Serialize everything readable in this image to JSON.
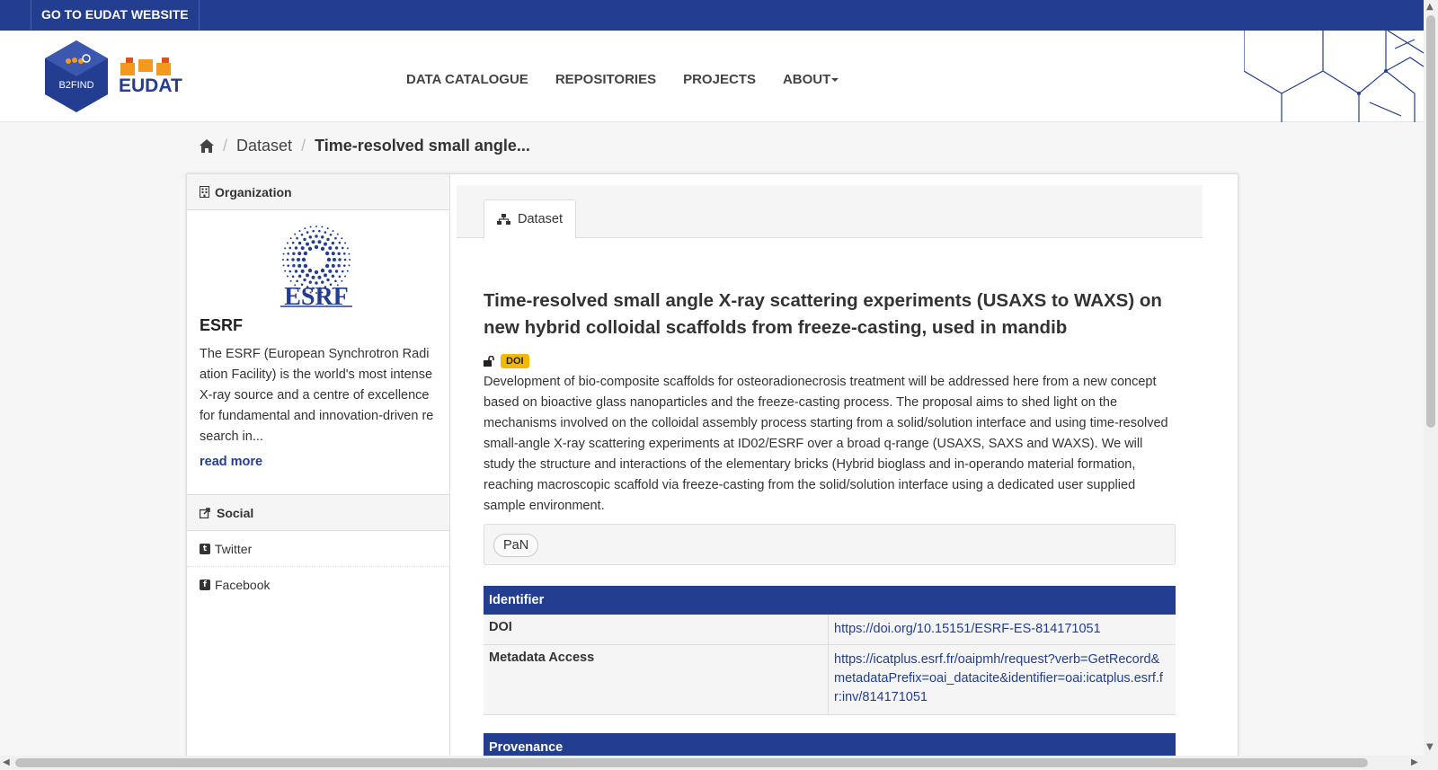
{
  "topbar": {
    "link_label": "GO TO EUDAT WEBSITE"
  },
  "header": {
    "b2find_label": "B2FIND",
    "eudat_label": "EUDAT",
    "nav": [
      "DATA CATALOGUE",
      "REPOSITORIES",
      "PROJECTS",
      "ABOUT"
    ]
  },
  "breadcrumb": {
    "items": [
      "Dataset",
      "Time-resolved small angle..."
    ]
  },
  "sidebar": {
    "org_heading": "Organization",
    "org_logo_text": "ESRF",
    "org_name": "ESRF",
    "org_description": "The ESRF (European Synchrotron Radiation Facility) is the world's most intense X-ray source and a centre of excellence for fundamental and innovation-driven research in...",
    "read_more": "read more",
    "social_heading": "Social",
    "social": [
      "Twitter",
      "Facebook"
    ]
  },
  "main": {
    "tab_label": "Dataset",
    "title": "Time-resolved small angle X-ray scattering experiments (USAXS to WAXS) on new hybrid colloidal scaffolds from freeze-casting, used in mandib",
    "doi_badge": "DOI",
    "description": "Development of bio-composite scaffolds for osteoradionecrosis treatment will be addressed here from a new concept based on bioactive glass nanoparticles and the freeze-casting process. The proposal aims to shed light on the mechanisms involved on the colloidal assembly process starting from a solid/solution interface and using time-resolved small-angle X-ray scattering experiments at ID02/ESRF over a broad q-range (USAXS, SAXS and WAXS). We will study the structure and interactions of the elementary bricks (Hybrid bioglass and in-operando material formation, reaching macroscopic scaffold via freeze-casting from the solid/solution interface using a dedicated user supplied sample environment.",
    "tags": [
      "PaN"
    ],
    "identifier_heading": "Identifier",
    "doi_label": "DOI",
    "doi_value": "https://doi.org/10.15151/ESRF-ES-814171051",
    "metadata_label": "Metadata Access",
    "metadata_value": "https://icatplus.esrf.fr/oaipmh/request?verb=GetRecord&metadataPrefix=oai_datacite&identifier=oai:icatplus.esrf.fr:inv/814171051",
    "provenance_heading": "Provenance"
  },
  "colors": {
    "brand_blue": "#233e90",
    "doi_badge": "#f5b800",
    "eudat_orange": "#f39a1e"
  }
}
